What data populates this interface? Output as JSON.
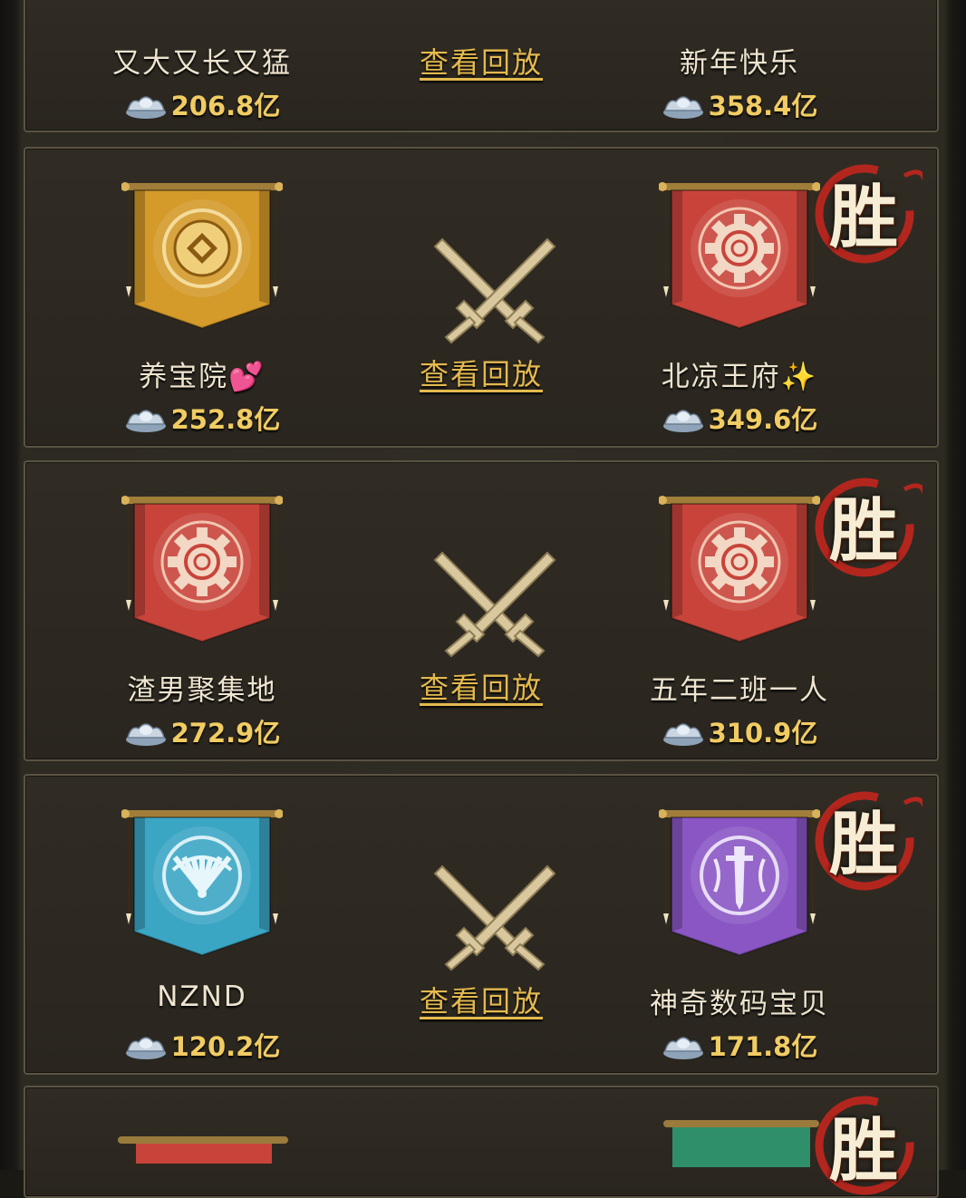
{
  "top_partial": {
    "left": {
      "name": "又大又长又猛",
      "amount": "206.8亿"
    },
    "replay_label": "查看回放",
    "right": {
      "name": "新年快乐",
      "amount": "358.4亿"
    }
  },
  "matches": [
    {
      "left": {
        "name": "养宝院💕",
        "amount": "252.8亿",
        "banner_color": "#d49a2a",
        "emblem": "coin-icon"
      },
      "replay_label": "查看回放",
      "right": {
        "name": "北凉王府✨",
        "amount": "349.6亿",
        "banner_color": "#c8443a",
        "emblem": "gear-icon"
      },
      "winner_label": "胜"
    },
    {
      "left": {
        "name": "渣男聚集地",
        "amount": "272.9亿",
        "banner_color": "#c8443a",
        "emblem": "gear-icon"
      },
      "replay_label": "查看回放",
      "right": {
        "name": "五年二班一人",
        "amount": "310.9亿",
        "banner_color": "#c8443a",
        "emblem": "gear-icon"
      },
      "winner_label": "胜"
    },
    {
      "left": {
        "name": "NZND",
        "amount": "120.2亿",
        "banner_color": "#3ba6c4",
        "emblem": "fan-icon"
      },
      "replay_label": "查看回放",
      "right": {
        "name": "神奇数码宝贝",
        "amount": "171.8亿",
        "banner_color": "#8a56c4",
        "emblem": "sword-icon"
      },
      "winner_label": "胜"
    }
  ],
  "bottom_partial": {
    "left": {
      "banner_color": "#c8443a"
    },
    "right": {
      "banner_color": "#2f8f6a"
    },
    "winner_label": "胜"
  },
  "colors": {
    "amount": "#f1cc63",
    "replay": "#e4b94d",
    "win_ring": "#b3261e"
  }
}
